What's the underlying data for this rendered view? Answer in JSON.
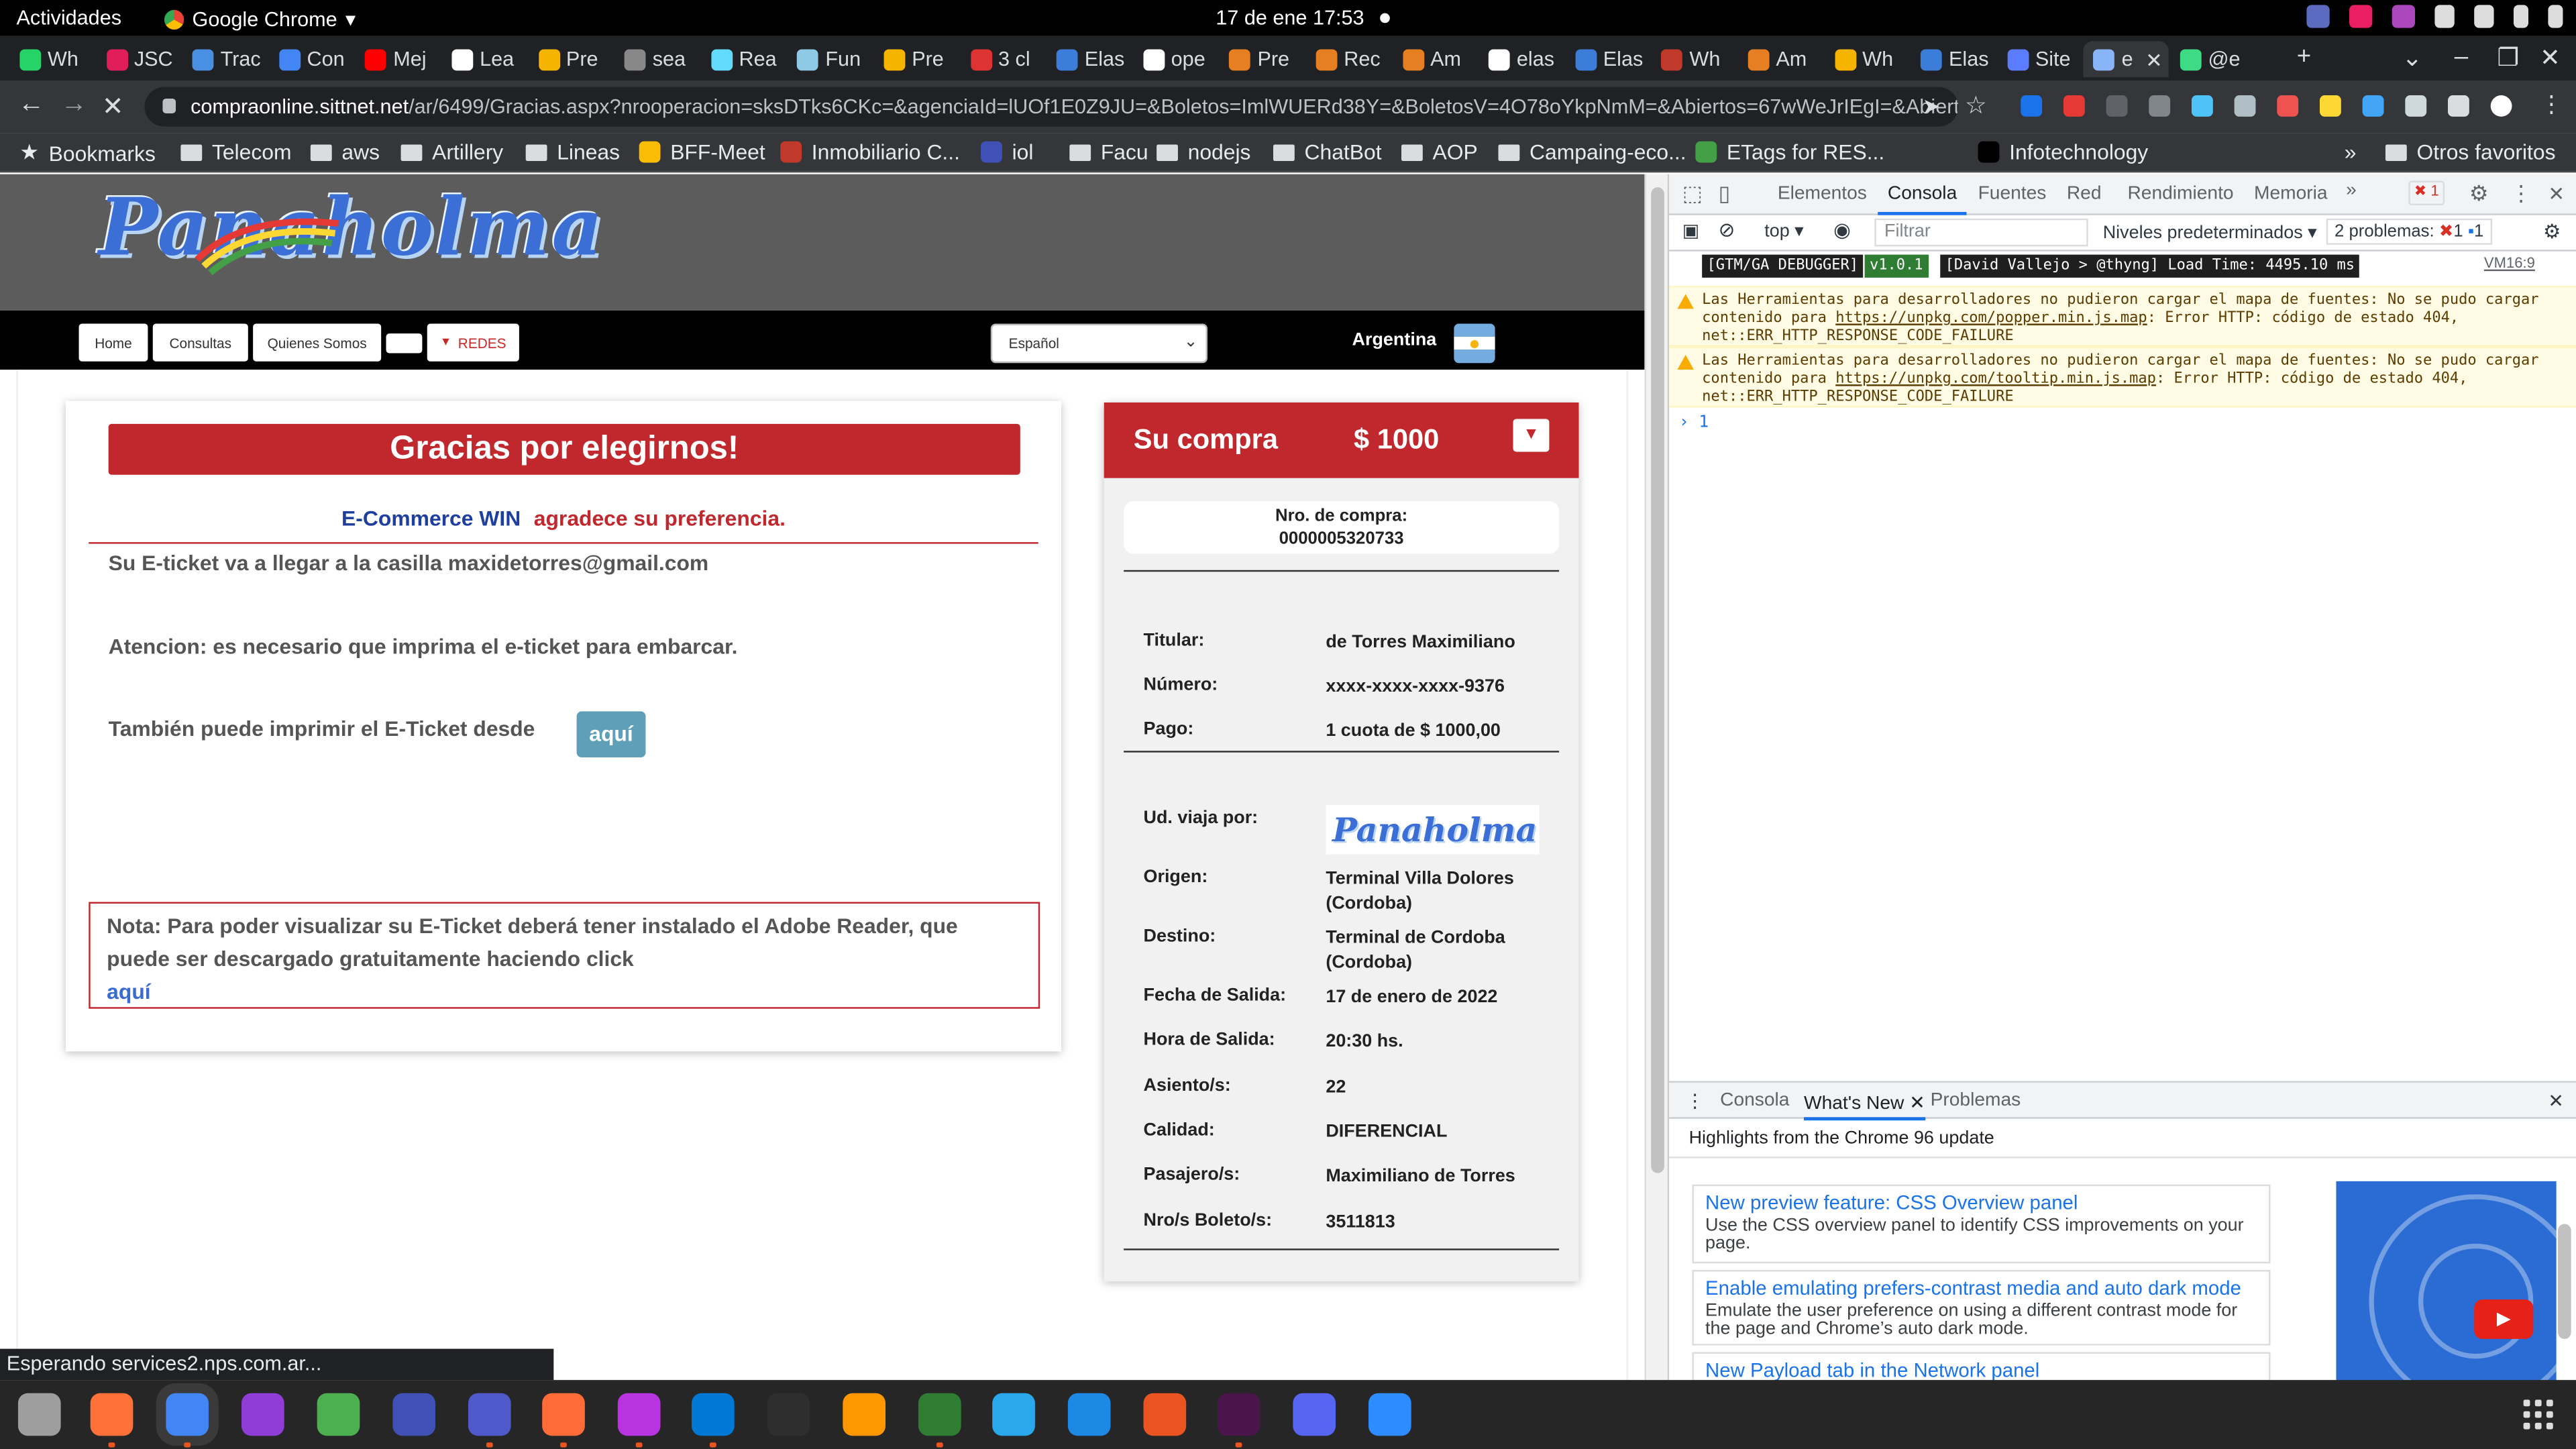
{
  "system": {
    "activities": "Actividades",
    "app_name": "Google Chrome",
    "clock": "17 de ene  17:53"
  },
  "tabs": [
    {
      "label": "Wh",
      "color": "#25d366"
    },
    {
      "label": "JSC",
      "color": "#e01e5a"
    },
    {
      "label": "Trac",
      "color": "#4a90e2"
    },
    {
      "label": "Con",
      "color": "#4285f4"
    },
    {
      "label": "Mej",
      "color": "#ff0000"
    },
    {
      "label": "Lea",
      "color": "#ffffff"
    },
    {
      "label": "Pre",
      "color": "#f4b400"
    },
    {
      "label": "sea",
      "color": "#888888"
    },
    {
      "label": "Rea",
      "color": "#61dafb"
    },
    {
      "label": "Fun",
      "color": "#8ecae6"
    },
    {
      "label": "Pre",
      "color": "#f4b400"
    },
    {
      "label": "3 cl",
      "color": "#d33"
    },
    {
      "label": "Elas",
      "color": "#3c7dd9"
    },
    {
      "label": "ope",
      "color": "#ffffff"
    },
    {
      "label": "Pre",
      "color": "#e67e22"
    },
    {
      "label": "Rec",
      "color": "#e67e22"
    },
    {
      "label": "Am",
      "color": "#e67e22"
    },
    {
      "label": "elas",
      "color": "#ffffff"
    },
    {
      "label": "Elas",
      "color": "#3c7dd9"
    },
    {
      "label": "Wh",
      "color": "#c0392b"
    },
    {
      "label": "Am",
      "color": "#e67e22"
    },
    {
      "label": "Wh",
      "color": "#f4b400"
    },
    {
      "label": "Elas",
      "color": "#3c7dd9"
    },
    {
      "label": "Site",
      "color": "#5b7cff"
    },
    {
      "label": "e",
      "color": "#8ab4f8",
      "active": true
    },
    {
      "label": "@e",
      "color": "#3ddc84"
    }
  ],
  "address_bar": {
    "host": "compraonline.sittnet.net",
    "path": "/ar/6499/Gracias.aspx?nrooperacion=sksDTks6CKc=&agenciaId=lUOf1E0Z9JU=&Boletos=ImlWUERd38Y=&BoletosV=4O78oYkpNmM=&Abiertos=67wWeJrIEgI=&AbiertosVige..."
  },
  "bookmarks": [
    {
      "label": "Bookmarks",
      "type": "star"
    },
    {
      "label": "Telecom",
      "type": "folder"
    },
    {
      "label": "aws",
      "type": "folder"
    },
    {
      "label": "Artillery",
      "type": "folder"
    },
    {
      "label": "Lineas",
      "type": "folder"
    },
    {
      "label": "BFF-Meet",
      "type": "icon",
      "color": "#fbbc04"
    },
    {
      "label": "Inmobiliario C...",
      "type": "icon",
      "color": "#c0392b"
    },
    {
      "label": "iol",
      "type": "icon",
      "color": "#3f51b5"
    },
    {
      "label": "Facu",
      "type": "folder"
    },
    {
      "label": "nodejs",
      "type": "folder"
    },
    {
      "label": "ChatBot",
      "type": "folder"
    },
    {
      "label": "AOP",
      "type": "folder"
    },
    {
      "label": "Campaing-eco...",
      "type": "folder"
    },
    {
      "label": "ETags for RES...",
      "type": "icon",
      "color": "#43a047"
    },
    {
      "label": "Infotechnology",
      "type": "icon",
      "color": "#000000"
    }
  ],
  "bookmarks_other": "Otros favoritos",
  "site": {
    "logo_text": "Panaholma",
    "nav": [
      "Home",
      "Consultas",
      "Quienes Somos",
      "",
      "REDES"
    ],
    "language": "Español",
    "country": "Argentina"
  },
  "confirmation": {
    "title": "Gracias por elegirnos!",
    "brand": "E-Commerce WIN",
    "thanks_text": "agradece su preferencia.",
    "email_line": "Su E-ticket va a llegar a la casilla maxidetorres@gmail.com",
    "attention": "Atencion: es necesario que imprima el e-ticket para embarcar.",
    "print_text": "También puede imprimir el E-Ticket desde",
    "print_button": "aquí",
    "note": "Nota: Para poder visualizar su E-Ticket deberá tener instalado el Adobe Reader, que puede ser descargado gratuitamente haciendo click",
    "note_link": "aquí"
  },
  "purchase": {
    "title": "Su compra",
    "amount": "$ 1000",
    "nro_label": "Nro. de compra:",
    "nro_value": "0000005320733",
    "payment": [
      {
        "k": "Titular:",
        "v": "de Torres Maximiliano"
      },
      {
        "k": "Número:",
        "v": "xxxx-xxxx-xxxx-9376"
      },
      {
        "k": "Pago:",
        "v": "1 cuota de $ 1000,00"
      }
    ],
    "travel_label": "Ud. viaja por:",
    "travel": [
      {
        "k": "Origen:",
        "v": "Terminal Villa Dolores (Cordoba)"
      },
      {
        "k": "Destino:",
        "v": "Terminal de Cordoba (Cordoba)"
      },
      {
        "k": "Fecha de Salida:",
        "v": "17 de enero de 2022"
      },
      {
        "k": "Hora de Salida:",
        "v": "20:30 hs."
      },
      {
        "k": "Asiento/s:",
        "v": "22"
      },
      {
        "k": "Calidad:",
        "v": "DIFERENCIAL"
      },
      {
        "k": "Pasajero/s:",
        "v": "Maximiliano de Torres"
      },
      {
        "k": "Nro/s Boleto/s:",
        "v": "3511813"
      }
    ]
  },
  "status_bar": "Esperando services2.nps.com.ar...",
  "devtools": {
    "tabs": [
      "Elementos",
      "Consola",
      "Fuentes",
      "Red",
      "Rendimiento",
      "Memoria"
    ],
    "active_tab": "Consola",
    "context": "top",
    "filter_placeholder": "Filtrar",
    "levels": "Niveles predeterminados",
    "problems": "2 problemas:",
    "problems_err": "1",
    "problems_info": "1",
    "error_badge": "1",
    "gtm_badge": "[GTM/GA DEBUGGER]",
    "gtm_version": "v1.0.1",
    "gtm_info": "[David Vallejo > @thyng] Load Time: 4495.10 ms",
    "gtm_src": "VM16:9",
    "warnings": [
      {
        "pre": "Las Herramientas para desarrolladores no pudieron cargar el mapa de fuentes: No se pudo cargar contenido para ",
        "link": "https://unpkg.com/popper.min.js.map",
        "post": ": Error HTTP: código de estado 404, net::ERR_HTTP_RESPONSE_CODE_FAILURE"
      },
      {
        "pre": "Las Herramientas para desarrolladores no pudieron cargar el mapa de fuentes: No se pudo cargar contenido para ",
        "link": "https://unpkg.com/tooltip.min.js.map",
        "post": ": Error HTTP: código de estado 404, net::ERR_HTTP_RESPONSE_CODE_FAILURE"
      }
    ],
    "prompt_value": "1",
    "drawer_tabs": [
      "Consola",
      "What's New",
      "Problemas"
    ],
    "drawer_active": "What's New",
    "drawer_header": "Highlights from the Chrome 96 update",
    "whats_new": [
      {
        "title": "New preview feature: CSS Overview panel",
        "desc": "Use the CSS overview panel to identify CSS improvements on your page."
      },
      {
        "title": "Enable emulating prefers-contrast media and auto dark mode",
        "desc": "Emulate the user preference on using a different contrast mode for the page and Chrome’s auto dark mode."
      },
      {
        "title": "New Payload tab in the Network panel",
        "desc": ""
      }
    ]
  },
  "dock": [
    {
      "name": "files",
      "color": "#9e9e9e",
      "dot": false
    },
    {
      "name": "firefox",
      "color": "#ff7139",
      "dot": true
    },
    {
      "name": "chrome",
      "color": "#4285f4",
      "dot": true
    },
    {
      "name": "firefox-dev",
      "color": "#8f3dd6",
      "dot": false
    },
    {
      "name": "xbox",
      "color": "#4caf50",
      "dot": false
    },
    {
      "name": "remote",
      "color": "#3f51b5",
      "dot": false
    },
    {
      "name": "teams",
      "color": "#5059c9",
      "dot": true
    },
    {
      "name": "postman",
      "color": "#ff6c37",
      "dot": true
    },
    {
      "name": "intellij",
      "color": "#b734e0",
      "dot": true
    },
    {
      "name": "vscode",
      "color": "#0078d4",
      "dot": true
    },
    {
      "name": "terminal",
      "color": "#2e2e2e",
      "dot": false
    },
    {
      "name": "sublime",
      "color": "#ff9800",
      "dot": false
    },
    {
      "name": "robo3t",
      "color": "#2e7d32",
      "dot": true
    },
    {
      "name": "telegram",
      "color": "#29a9eb",
      "dot": false
    },
    {
      "name": "screenshot",
      "color": "#1e88e5",
      "dot": false
    },
    {
      "name": "software",
      "color": "#e95420",
      "dot": false
    },
    {
      "name": "slack",
      "color": "#4a154b",
      "dot": true
    },
    {
      "name": "discord",
      "color": "#5865f2",
      "dot": false
    },
    {
      "name": "zoom",
      "color": "#2d8cff",
      "dot": false
    }
  ]
}
